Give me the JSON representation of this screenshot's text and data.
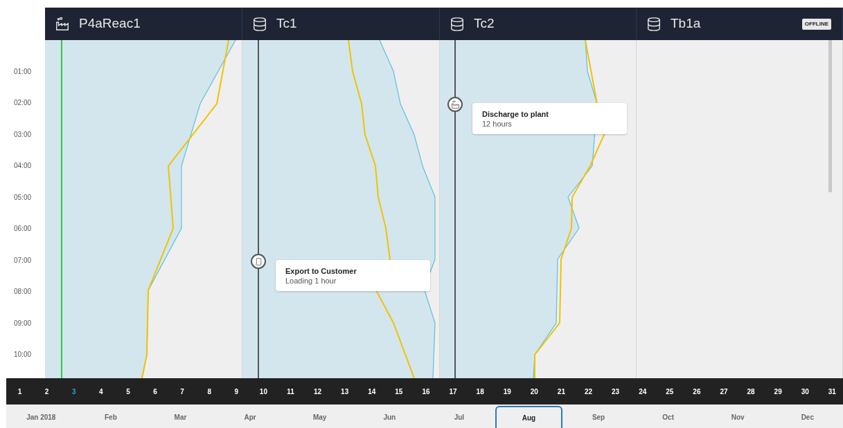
{
  "columns": [
    {
      "name": "P4aReac1",
      "kind": "reactor",
      "track": {
        "color": "#2ecc40"
      }
    },
    {
      "name": "Tc1",
      "kind": "tank",
      "track": {
        "color": "#555555"
      },
      "event": {
        "kind": "export",
        "title": "Export to Customer",
        "subtitle": "Loading 1 hour"
      }
    },
    {
      "name": "Tc2",
      "kind": "tank",
      "track": {
        "color": "#555555"
      },
      "event": {
        "kind": "discharge",
        "title": "Discharge to plant",
        "subtitle": "12 hours"
      }
    },
    {
      "name": "Tb1a",
      "kind": "tank",
      "badge": "OFFLINE"
    }
  ],
  "hours": [
    "01:00",
    "02:00",
    "03:00",
    "04:00",
    "05:00",
    "06:00",
    "07:00",
    "08:00",
    "09:00",
    "10:00"
  ],
  "days": [
    {
      "label": "1",
      "selected": false
    },
    {
      "label": "2",
      "selected": false
    },
    {
      "label": "3",
      "selected": true
    },
    {
      "label": "4",
      "selected": false
    },
    {
      "label": "5",
      "selected": false
    },
    {
      "label": "6",
      "selected": false
    },
    {
      "label": "7",
      "selected": false
    },
    {
      "label": "8",
      "selected": false
    },
    {
      "label": "9",
      "selected": false
    },
    {
      "label": "10",
      "selected": false
    },
    {
      "label": "11",
      "selected": false
    },
    {
      "label": "12",
      "selected": false
    },
    {
      "label": "13",
      "selected": false
    },
    {
      "label": "14",
      "selected": false
    },
    {
      "label": "15",
      "selected": false
    },
    {
      "label": "16",
      "selected": false
    },
    {
      "label": "17",
      "selected": false
    },
    {
      "label": "18",
      "selected": false
    },
    {
      "label": "19",
      "selected": false
    },
    {
      "label": "20",
      "selected": false
    },
    {
      "label": "21",
      "selected": false
    },
    {
      "label": "22",
      "selected": false
    },
    {
      "label": "23",
      "selected": false
    },
    {
      "label": "24",
      "selected": false
    },
    {
      "label": "25",
      "selected": false
    },
    {
      "label": "26",
      "selected": false
    },
    {
      "label": "27",
      "selected": false
    },
    {
      "label": "28",
      "selected": false
    },
    {
      "label": "29",
      "selected": false
    },
    {
      "label": "30",
      "selected": false
    },
    {
      "label": "31",
      "selected": false
    }
  ],
  "months": [
    {
      "label": "Jan 2018",
      "selected": false
    },
    {
      "label": "Feb",
      "selected": false
    },
    {
      "label": "Mar",
      "selected": false
    },
    {
      "label": "Apr",
      "selected": false
    },
    {
      "label": "May",
      "selected": false
    },
    {
      "label": "Jun",
      "selected": false
    },
    {
      "label": "Jul",
      "selected": false
    },
    {
      "label": "Aug",
      "selected": true
    },
    {
      "label": "Sep",
      "selected": false
    },
    {
      "label": "Oct",
      "selected": false
    },
    {
      "label": "Nov",
      "selected": false
    },
    {
      "label": "Dec",
      "selected": false
    }
  ]
}
